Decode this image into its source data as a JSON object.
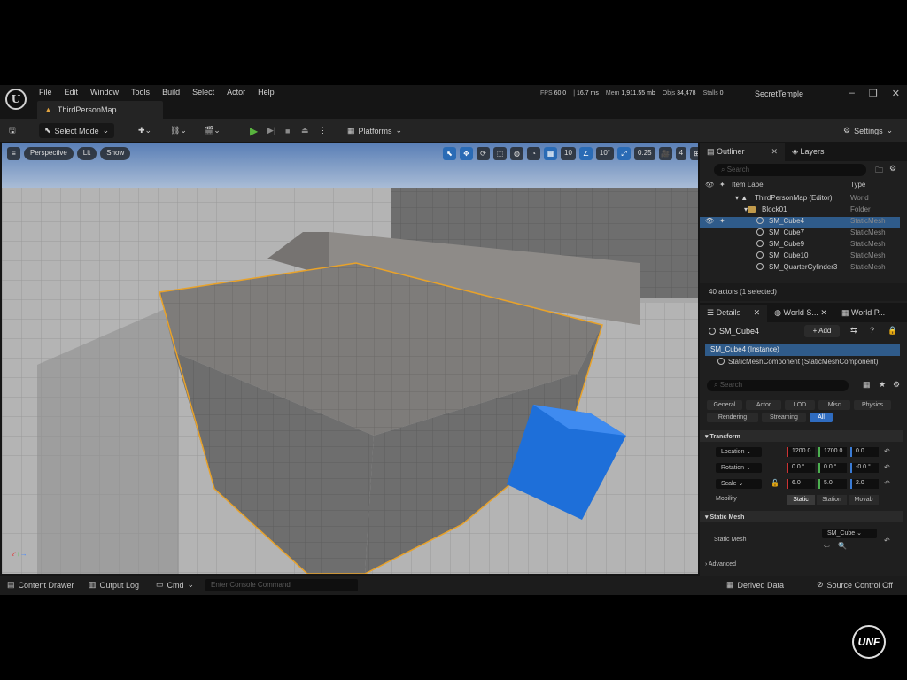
{
  "menubar": {
    "logo": "U",
    "items": [
      "File",
      "Edit",
      "Window",
      "Tools",
      "Build",
      "Select",
      "Actor",
      "Help"
    ],
    "stats": [
      {
        "label": "FPS",
        "value": "60.0"
      },
      {
        "label": "",
        "value": "16.7 ms"
      },
      {
        "label": "Mem",
        "value": "1,911.55 mb"
      },
      {
        "label": "Objs",
        "value": "34,478"
      },
      {
        "label": "Stalls",
        "value": "0"
      }
    ],
    "project": "SecretTemple",
    "map_tab": "ThirdPersonMap"
  },
  "toolbar": {
    "select_mode": "Select Mode",
    "platforms": "Platforms",
    "settings": "Settings"
  },
  "viewport": {
    "perspective": "Perspective",
    "lit": "Lit",
    "show": "Show",
    "grid_snap": "10",
    "rot_snap": "10°",
    "scale_snap": "0.25",
    "camera_speed": "4",
    "selected_color": "#1e6fd9",
    "highlight_color": "#e8a22a"
  },
  "outliner": {
    "tab": "Outliner",
    "layers_tab": "Layers",
    "search_placeholder": "Search",
    "col_label": "Item Label",
    "col_type": "Type",
    "rows": [
      {
        "name": "ThirdPersonMap (Editor)",
        "type": "World"
      },
      {
        "name": "Block01",
        "type": "Folder"
      },
      {
        "name": "SM_Cube4",
        "type": "StaticMesh"
      },
      {
        "name": "SM_Cube7",
        "type": "StaticMesh"
      },
      {
        "name": "SM_Cube9",
        "type": "StaticMesh"
      },
      {
        "name": "SM_Cube10",
        "type": "StaticMesh"
      },
      {
        "name": "SM_QuarterCylinder3",
        "type": "StaticMesh"
      }
    ],
    "status": "40 actors (1 selected)"
  },
  "details": {
    "tab": "Details",
    "world_tab": "World S...",
    "world_p_tab": "World P...",
    "actor": "SM_Cube4",
    "add": "+ Add",
    "instance": "SM_Cube4 (Instance)",
    "component": "StaticMeshComponent (StaticMeshComponent)",
    "search_placeholder": "Search",
    "filters": [
      "General",
      "Actor",
      "LOD",
      "Misc",
      "Physics",
      "Rendering",
      "Streaming",
      "All"
    ],
    "transform_title": "Transform",
    "location_label": "Location",
    "location": [
      "1200.0",
      "1700.0",
      "0.0"
    ],
    "rotation_label": "Rotation",
    "rotation": [
      "0.0 °",
      "0.0 °",
      "-0.0 °"
    ],
    "scale_label": "Scale",
    "scale": [
      "6.0",
      "5.0",
      "2.0"
    ],
    "mobility_label": "Mobility",
    "mobility": [
      "Static",
      "Station",
      "Movab"
    ],
    "static_mesh_title": "Static Mesh",
    "static_mesh_label": "Static Mesh",
    "static_mesh_value": "SM_Cube",
    "advanced": "Advanced"
  },
  "bottombar": {
    "content_drawer": "Content Drawer",
    "output_log": "Output Log",
    "cmd": "Cmd",
    "console_placeholder": "Enter Console Command",
    "derived_data": "Derived Data",
    "source_control": "Source Control Off"
  },
  "watermark": "UNF"
}
